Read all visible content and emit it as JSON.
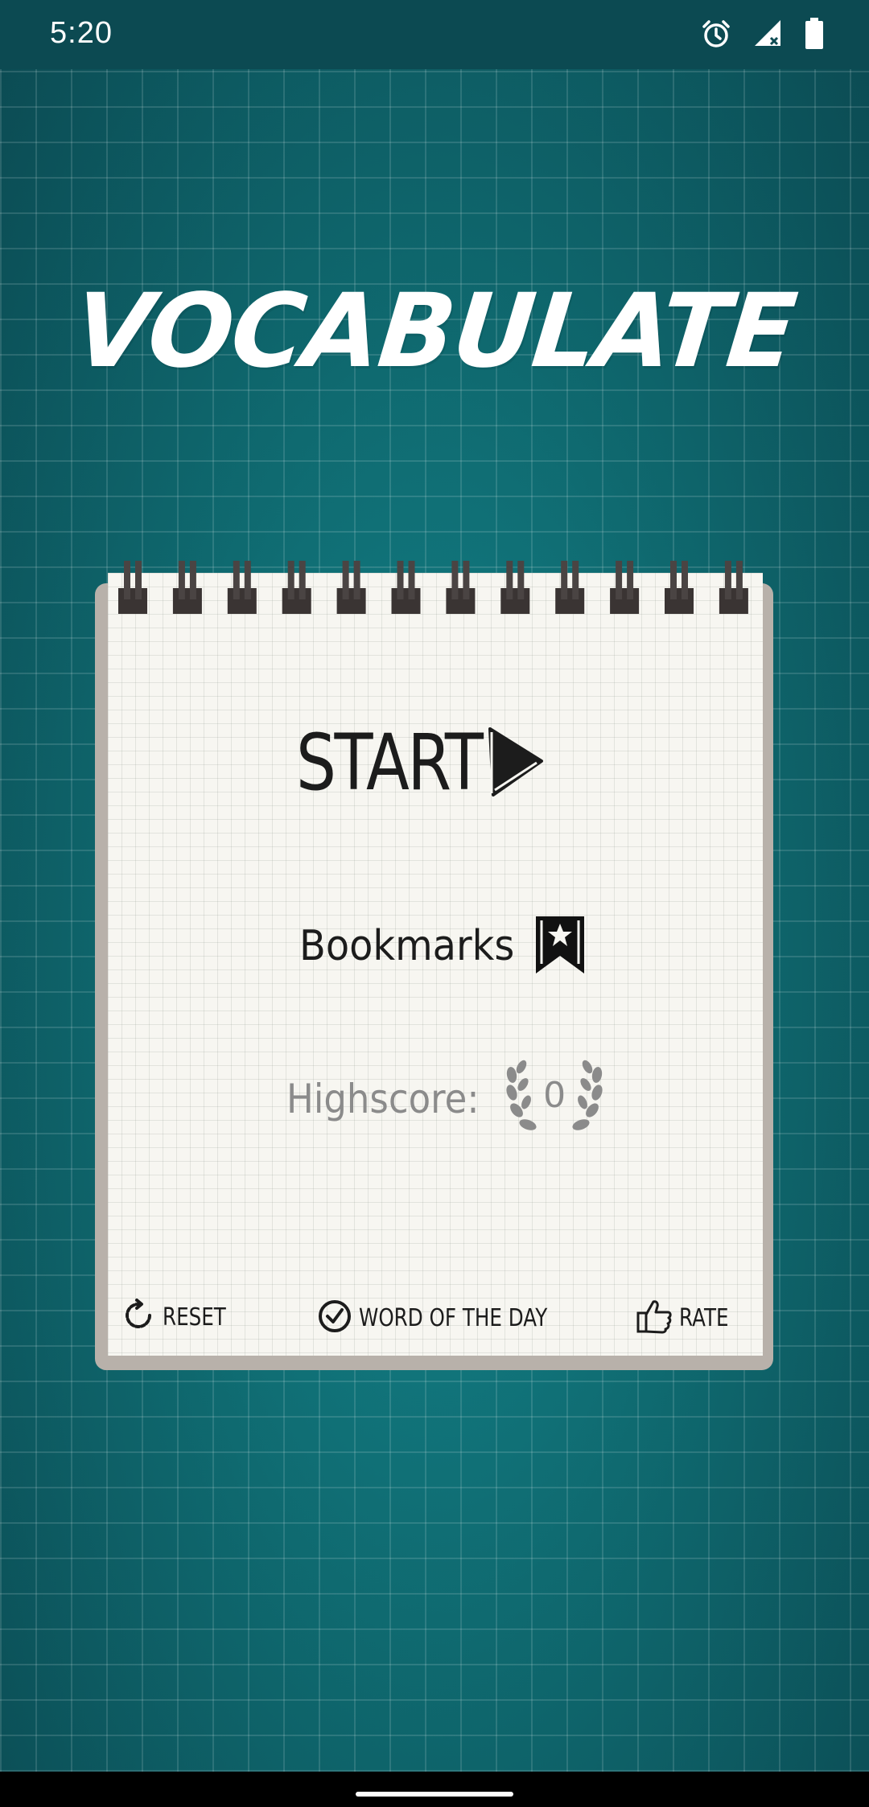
{
  "status_bar": {
    "time": "5:20",
    "icons": [
      "alarm-icon",
      "signal-icon",
      "battery-icon"
    ]
  },
  "app": {
    "title": "VOCABULATE"
  },
  "menu": {
    "start_label": "START",
    "bookmarks_label": "Bookmarks",
    "highscore_label": "Highscore:",
    "highscore_value": "0"
  },
  "footer": {
    "reset_label": "RESET",
    "word_of_the_day_label": "WORD OF THE DAY",
    "rate_label": "RATE"
  },
  "colors": {
    "background": "#0f6a70",
    "status_bar": "#0c4a52",
    "paper": "#f7f6f1",
    "ink": "#1c1c1c",
    "muted_ink": "#8b8b8b"
  }
}
